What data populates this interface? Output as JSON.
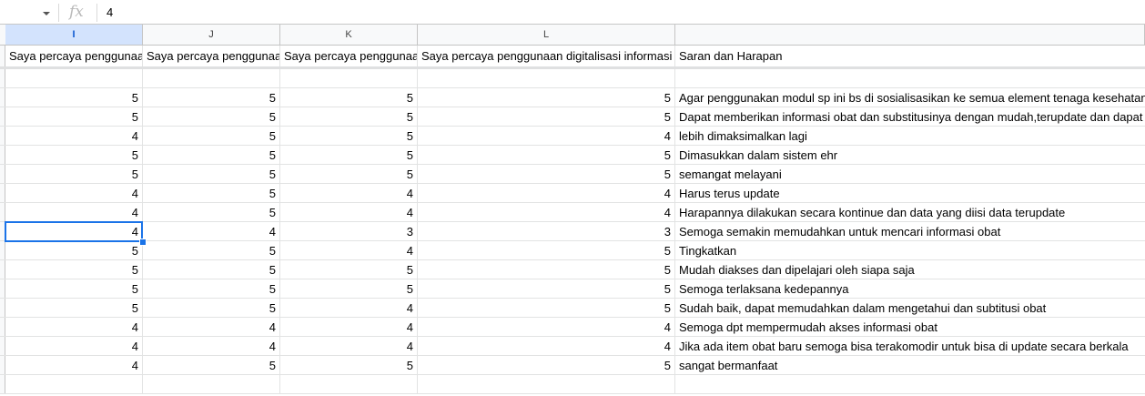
{
  "formula_bar": {
    "fx_symbol": "fx",
    "value": "4"
  },
  "columns": [
    "I",
    "J",
    "K",
    "L",
    ""
  ],
  "selected_column": "I",
  "headers": [
    "Saya percaya penggunaan digitalisasi informasi",
    "Saya percaya penggunaan digitalisasi informasi",
    "Saya percaya penggunaan digitalisasi informasi",
    "Saya percaya penggunaan digitalisasi informasi obat",
    "Saran dan Harapan"
  ],
  "rows": [
    [
      "",
      "",
      "",
      "",
      ""
    ],
    [
      "5",
      "5",
      "5",
      "5",
      "Agar penggunakan modul sp ini bs di sosialisasikan ke semua element tenaga kesehatan"
    ],
    [
      "5",
      "5",
      "5",
      "5",
      "Dapat memberikan informasi obat dan substitusinya dengan mudah,terupdate dan dapat dipercaya"
    ],
    [
      "4",
      "5",
      "5",
      "4",
      "lebih dimaksimalkan lagi"
    ],
    [
      "5",
      "5",
      "5",
      "5",
      "Dimasukkan dalam sistem ehr"
    ],
    [
      "5",
      "5",
      "5",
      "5",
      "semangat melayani"
    ],
    [
      "4",
      "5",
      "4",
      "4",
      "Harus terus update"
    ],
    [
      "4",
      "5",
      "4",
      "4",
      "Harapannya dilakukan secara kontinue dan data yang diisi data terupdate"
    ],
    [
      "4",
      "4",
      "3",
      "3",
      "Semoga semakin memudahkan untuk mencari informasi obat"
    ],
    [
      "5",
      "5",
      "4",
      "5",
      "Tingkatkan"
    ],
    [
      "5",
      "5",
      "5",
      "5",
      "Mudah diakses dan dipelajari oleh siapa saja"
    ],
    [
      "5",
      "5",
      "5",
      "5",
      "Semoga terlaksana kedepannya"
    ],
    [
      "5",
      "5",
      "4",
      "5",
      "Sudah baik, dapat memudahkan dalam mengetahui dan subtitusi obat"
    ],
    [
      "4",
      "4",
      "4",
      "4",
      "Semoga dpt mempermudah akses informasi obat"
    ],
    [
      "4",
      "4",
      "4",
      "4",
      "Jika ada item obat baru semoga bisa terakomodir untuk bisa di update secara berkala"
    ],
    [
      "4",
      "5",
      "5",
      "5",
      "sangat bermanfaat"
    ],
    [
      "",
      "",
      "",
      "",
      ""
    ]
  ],
  "colors": {
    "selection": "#1a73e8",
    "header_bg": "#f8f9fa",
    "gridline": "#e2e3e3"
  }
}
